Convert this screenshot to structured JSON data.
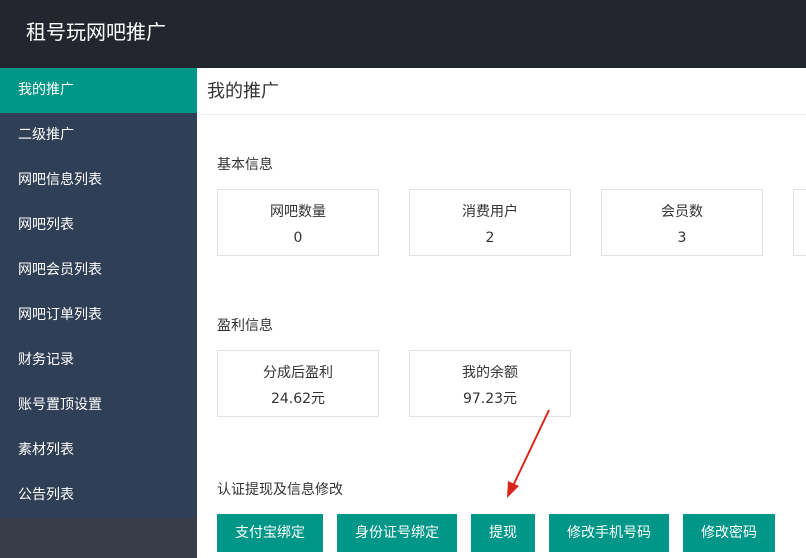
{
  "header": {
    "title": "租号玩网吧推广"
  },
  "sidebar": {
    "items": [
      {
        "label": "我的推广"
      },
      {
        "label": "二级推广"
      },
      {
        "label": "网吧信息列表"
      },
      {
        "label": "网吧列表"
      },
      {
        "label": "网吧会员列表"
      },
      {
        "label": "网吧订单列表"
      },
      {
        "label": "财务记录"
      },
      {
        "label": "账号置顶设置"
      },
      {
        "label": "素材列表"
      },
      {
        "label": "公告列表"
      }
    ]
  },
  "main": {
    "title": "我的推广",
    "basic": {
      "label": "基本信息",
      "cards": [
        {
          "label": "网吧数量",
          "value": "0"
        },
        {
          "label": "消费用户",
          "value": "2"
        },
        {
          "label": "会员数",
          "value": "3"
        }
      ]
    },
    "profit": {
      "label": "盈利信息",
      "cards": [
        {
          "label": "分成后盈利",
          "value": "24.62元"
        },
        {
          "label": "我的余额",
          "value": "97.23元"
        }
      ]
    },
    "actions": {
      "label": "认证提现及信息修改",
      "buttons": [
        {
          "label": "支付宝绑定"
        },
        {
          "label": "身份证号绑定"
        },
        {
          "label": "提现"
        },
        {
          "label": "修改手机号码"
        },
        {
          "label": "修改密码"
        }
      ]
    }
  },
  "colors": {
    "accent": "#009688",
    "sidebar": "#2f4056",
    "header": "#23262e",
    "arrow": "#d9261c"
  }
}
